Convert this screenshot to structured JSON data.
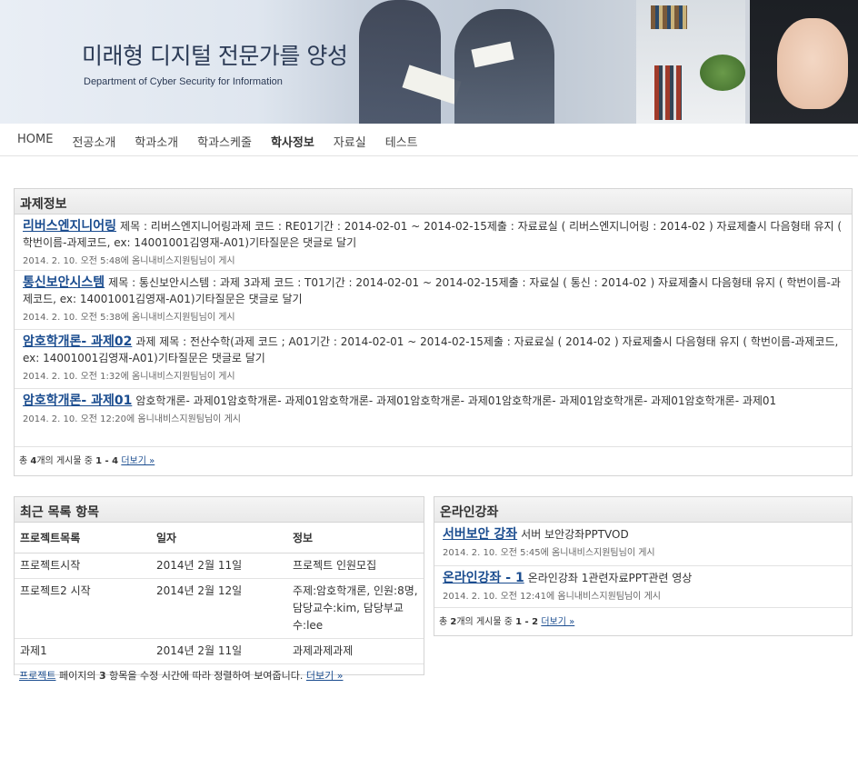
{
  "banner": {
    "title": "미래형 디지털 전문가를 양성",
    "subtitle": "Department of Cyber Security for Information"
  },
  "nav": {
    "items": [
      "HOME",
      "전공소개",
      "학과소개",
      "학과스케줄",
      "학사정보",
      "자료실",
      "테스트"
    ],
    "active": "학사정보"
  },
  "assignments": {
    "header": "과제정보",
    "posts": [
      {
        "title": "리버스엔지니어링",
        "body": "제목 : 리버스엔지니어링과제 코드 : RE01기간 : 2014-02-01 ~ 2014-02-15제출 : 자료료실 ( 리버스엔지니어링 :  2014-02 )        자료제출시 다음형태 유지 ( 학번이름-과제코드, ex: 14001001김영재-A01)기타질문은 댓글로 달기",
        "meta": "2014. 2. 10. 오전 5:48에 옴니내비스지원팀님이 게시"
      },
      {
        "title": "통신보안시스템",
        "body": "제목 : 통신보안시스템 : 과제 3과제 코드 : T01기간 : 2014-02-01 ~ 2014-02-15제출 : 자료실 ( 통신 : 2014-02 )        자료제출시 다음형태 유지 ( 학번이름-과제코드, ex: 14001001김영재-A01)기타질문은 댓글로 달기",
        "meta": "2014. 2. 10. 오전 5:38에 옴니내비스지원팀님이 게시"
      },
      {
        "title": "암호학개론- 과제02",
        "body": "과제 제목 : 전산수학(과제 코드 ; A01기간 : 2014-02-01 ~ 2014-02-15제출 : 자료료실 ( 2014-02 )        자료제출시 다음형태 유지 ( 학번이름-과제코드, ex: 14001001김영재-A01)기타질문은 댓글로 달기",
        "meta": "2014. 2. 10. 오전 1:32에 옴니내비스지원팀님이 게시"
      },
      {
        "title": "암호학개론- 과제01",
        "body": "암호학개론- 과제01암호학개론- 과제01암호학개론- 과제01암호학개론- 과제01암호학개론- 과제01암호학개론- 과제01암호학개론- 과제01",
        "meta": "2014. 2. 10. 오전 12:20에 옴니내비스지원팀님이 게시"
      }
    ],
    "footer_prefix": "총 ",
    "footer_count": "4",
    "footer_mid": "개의 게시물 중 ",
    "footer_range": "1 - 4",
    "footer_more": "더보기 »"
  },
  "recent": {
    "header": "최근 목록 항목",
    "columns": [
      "프로젝트목록",
      "일자",
      "정보"
    ],
    "rows": [
      [
        "프로젝트시작",
        "2014년 2월 11일",
        "프로젝트 인원모집"
      ],
      [
        "프로젝트2 시작",
        "2014년 2월 12일",
        "주제:암호학개론, 인원:8명, 담당교수:kim, 담당부교수:lee"
      ],
      [
        "과제1",
        "2014년 2월 11일",
        "과제과제과제"
      ]
    ],
    "footer_link": "프로젝트",
    "footer_text1": " 페이지의 ",
    "footer_count": "3",
    "footer_text2": " 항목을 수정 시간에 따라 정렬하여 보여줍니다. ",
    "footer_more": "더보기 »"
  },
  "online": {
    "header": "온라인강좌",
    "posts": [
      {
        "title": "서버보안 강좌",
        "body": "서버 보안강좌PPTVOD",
        "meta": "2014. 2. 10. 오전 5:45에 옴니내비스지원팀님이 게시"
      },
      {
        "title": "온라인강좌 - 1",
        "body": "온라인강좌 1관련자료PPT관련 영상",
        "meta": "2014. 2. 10. 오전 12:41에 옴니내비스지원팀님이 게시"
      }
    ],
    "footer_prefix": "총 ",
    "footer_count": "2",
    "footer_mid": "개의 게시물 중 ",
    "footer_range": "1 - 2",
    "footer_more": "더보기 »"
  }
}
